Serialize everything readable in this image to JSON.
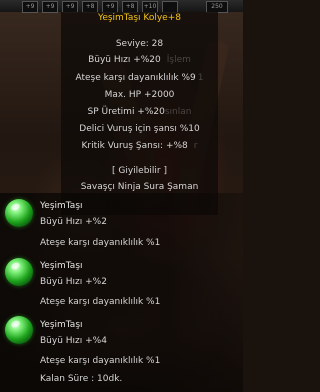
{
  "slot_bar": [
    "+9",
    "+9",
    "+9",
    "+8",
    "+9",
    "+8",
    "+10",
    "",
    "250"
  ],
  "item": {
    "name": "YeşimTaşı Kolye+8",
    "level": "Seviye: 28",
    "stats": [
      {
        "text": "Büyü Hızı +%20",
        "ghost": "İşlem"
      },
      {
        "text": "Ateşe karşı dayanıklılık %9",
        "ghost": "1"
      },
      {
        "text": "Max. HP +2000",
        "ghost": ""
      },
      {
        "text": "SP Üretimi +%20",
        "ghost": "sınlan"
      },
      {
        "text": "Delici Vuruş için şansı %10",
        "ghost": ""
      },
      {
        "text": "Kritik Vuruş Şansı: +%8",
        "ghost": "r"
      }
    ],
    "wearable_label": "[ Giyilebilir ]",
    "classes": "Savaşçı Ninja Sura Şaman"
  },
  "sockets": [
    {
      "icon": "green-jade-gem-icon",
      "name": "YeşimTaşı",
      "line1": "Büyü Hızı +%2",
      "line2": "Ateşe karşı dayanıklılık %1"
    },
    {
      "icon": "green-jade-gem-icon",
      "name": "YeşimTaşı",
      "line1": "Büyü Hızı +%2",
      "line2": "Ateşe karşı dayanıklılık %1"
    },
    {
      "icon": "green-jade-gem-icon",
      "name": "YeşimTaşı",
      "line1": "Büyü Hızı +%4",
      "line2": "Ateşe karşı dayanıklılık %1"
    }
  ],
  "remaining_time": "Kalan Süre : 10dk."
}
